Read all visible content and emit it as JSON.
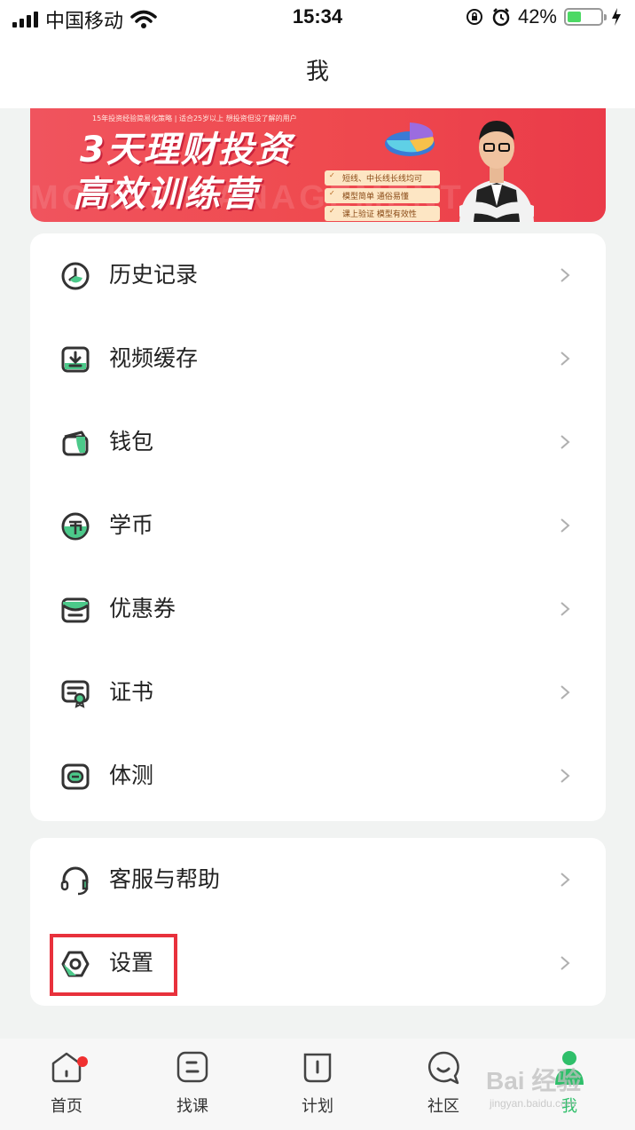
{
  "status_bar": {
    "carrier": "中国移动",
    "time": "15:34",
    "battery": "42%",
    "battery_level": 0.42
  },
  "nav": {
    "title": "我"
  },
  "banner": {
    "small_text": "15年投资经验简易化策略 | 适合25岁以上 想投资但没了解的用户",
    "line1": "3天理财投资",
    "line2": "高效训练营",
    "watermark": "MONEY MANAGEMENT",
    "tags": [
      "短线、中长线长线均可",
      "模型简单 通俗易懂",
      "课上验证 模型有效性"
    ]
  },
  "menu": {
    "items": [
      {
        "label": "历史记录",
        "icon": "clock-icon"
      },
      {
        "label": "视频缓存",
        "icon": "download-icon"
      },
      {
        "label": "钱包",
        "icon": "wallet-icon"
      },
      {
        "label": "学币",
        "icon": "coin-icon"
      },
      {
        "label": "优惠券",
        "icon": "coupon-icon"
      },
      {
        "label": "证书",
        "icon": "certificate-icon"
      },
      {
        "label": "体测",
        "icon": "test-icon"
      }
    ]
  },
  "help_menu": {
    "items": [
      {
        "label": "客服与帮助",
        "icon": "headset-icon"
      },
      {
        "label": "设置",
        "icon": "settings-icon"
      }
    ]
  },
  "tabs": [
    {
      "label": "首页",
      "icon": "home-icon",
      "badge": true
    },
    {
      "label": "找课",
      "icon": "course-icon"
    },
    {
      "label": "计划",
      "icon": "plan-icon"
    },
    {
      "label": "社区",
      "icon": "community-icon"
    },
    {
      "label": "我",
      "icon": "profile-icon",
      "active": true
    }
  ],
  "watermark": {
    "main": "Bai 经验",
    "sub": "jingyan.baidu.com"
  },
  "colors": {
    "accent": "#2fbf6a",
    "icon_stroke": "#333333",
    "icon_fill": "#4cc98a",
    "highlight": "#e8313c"
  }
}
